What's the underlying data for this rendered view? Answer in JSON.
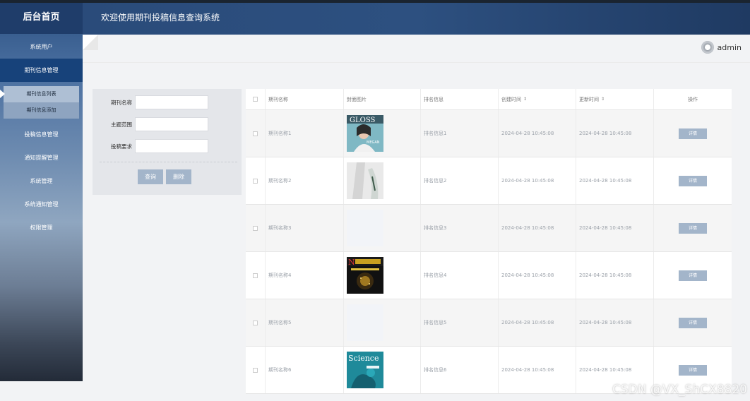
{
  "sidebar": {
    "title": "后台首页",
    "items": [
      {
        "label": "系统用户"
      },
      {
        "label": "期刊信息管理"
      },
      {
        "label": "投稿信息管理"
      },
      {
        "label": "通知提醒管理"
      },
      {
        "label": "系统管理"
      },
      {
        "label": "系统通知管理"
      },
      {
        "label": "权限管理"
      }
    ],
    "subitems": [
      {
        "label": "期刊信息列表"
      },
      {
        "label": "期刊信息添加"
      }
    ]
  },
  "header": {
    "title": "欢迎使用期刊投稿信息查询系统"
  },
  "user": {
    "name": "admin"
  },
  "search": {
    "fields": [
      {
        "label": "期刊名称",
        "value": ""
      },
      {
        "label": "主题范围",
        "value": ""
      },
      {
        "label": "投稿要求",
        "value": ""
      }
    ],
    "query_label": "查询",
    "delete_label": "删除"
  },
  "table": {
    "headers": [
      "期刊名称",
      "封面图片",
      "排名信息",
      "创建时间",
      "更新时间",
      "操作"
    ],
    "sort_icon": "⇕",
    "detail_label": "详情",
    "rows": [
      {
        "name": "期刊名称1",
        "rank": "排名信息1",
        "created": "2024-04-28 10:45:08",
        "updated": "2024-04-28 10:45:08",
        "cover": "magazine-cover-woman"
      },
      {
        "name": "期刊名称2",
        "rank": "排名信息2",
        "created": "2024-04-28 10:45:08",
        "updated": "2024-04-28 10:45:08",
        "cover": "fashion-photo"
      },
      {
        "name": "期刊名称3",
        "rank": "排名信息3",
        "created": "2024-04-28 10:45:08",
        "updated": "2024-04-28 10:45:08",
        "cover": "blank"
      },
      {
        "name": "期刊名称4",
        "rank": "排名信息4",
        "created": "2024-04-28 10:45:08",
        "updated": "2024-04-28 10:45:08",
        "cover": "science-world-cover"
      },
      {
        "name": "期刊名称5",
        "rank": "排名信息5",
        "created": "2024-04-28 10:45:08",
        "updated": "2024-04-28 10:45:08",
        "cover": "blank"
      },
      {
        "name": "期刊名称6",
        "rank": "排名信息6",
        "created": "2024-04-28 10:45:08",
        "updated": "2024-04-28 10:45:08",
        "cover": "science-cover"
      }
    ]
  },
  "watermark": "CSDN @VX_ShCX8820",
  "colors": {
    "header": "#2a4b7a",
    "sidebar_active": "#17427a",
    "button": "#a3b5ca"
  }
}
